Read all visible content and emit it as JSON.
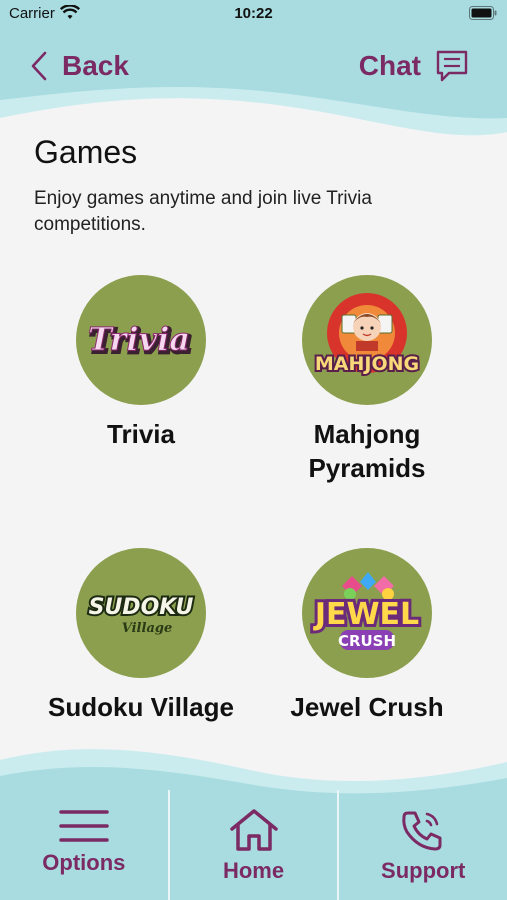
{
  "status_bar": {
    "carrier": "Carrier",
    "time": "10:22"
  },
  "header": {
    "back_label": "Back",
    "chat_label": "Chat"
  },
  "page": {
    "title": "Games",
    "description": "Enjoy games anytime and join live Trivia competitions."
  },
  "games": [
    {
      "name": "Trivia",
      "logo_text": "Trivia"
    },
    {
      "name": "Mahjong Pyramids",
      "logo_text": "MAHJONG"
    },
    {
      "name": "Sudoku Village",
      "logo_text": "SUDOKU",
      "logo_subtext": "Village"
    },
    {
      "name": "Jewel Crush",
      "logo_text": "JEWEL",
      "logo_subtext": "CRUSH"
    }
  ],
  "nav": [
    {
      "label": "Options",
      "icon": "hamburger-icon"
    },
    {
      "label": "Home",
      "icon": "home-icon"
    },
    {
      "label": "Support",
      "icon": "phone-icon"
    }
  ],
  "colors": {
    "accent": "#7b2a64",
    "wave": "#a9dce0",
    "circle": "#8c9f4e"
  }
}
